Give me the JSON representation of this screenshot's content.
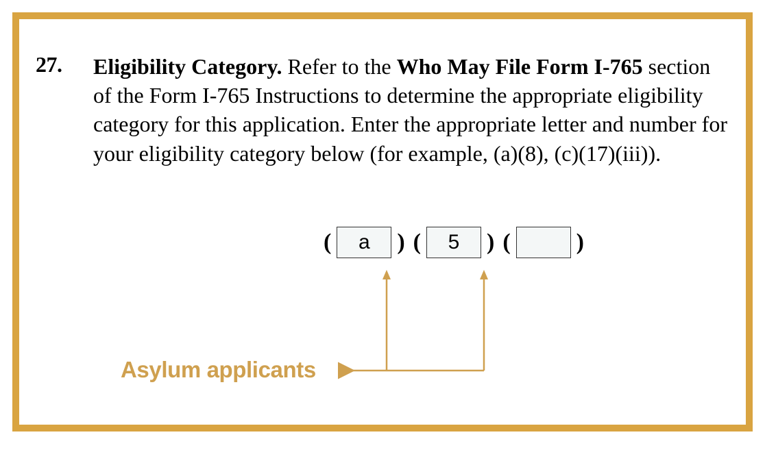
{
  "item": {
    "number": "27.",
    "bold1": "Eligibility Category.",
    "text1": "  Refer to the ",
    "bold2": "Who May File Form I-765",
    "text2": " section of the Form I-765 Instructions to determine the appropriate eligibility category for this application. Enter the appropriate letter and number for your eligibility category below (for example, (a)(8), (c)(17)(iii))."
  },
  "category": {
    "paren_open": "(",
    "paren_close": ")",
    "box1": "a",
    "box2": "5",
    "box3": ""
  },
  "annotation": {
    "label": "Asylum applicants"
  },
  "colors": {
    "border": "#d9a441",
    "annotation": "#cfa04f"
  }
}
